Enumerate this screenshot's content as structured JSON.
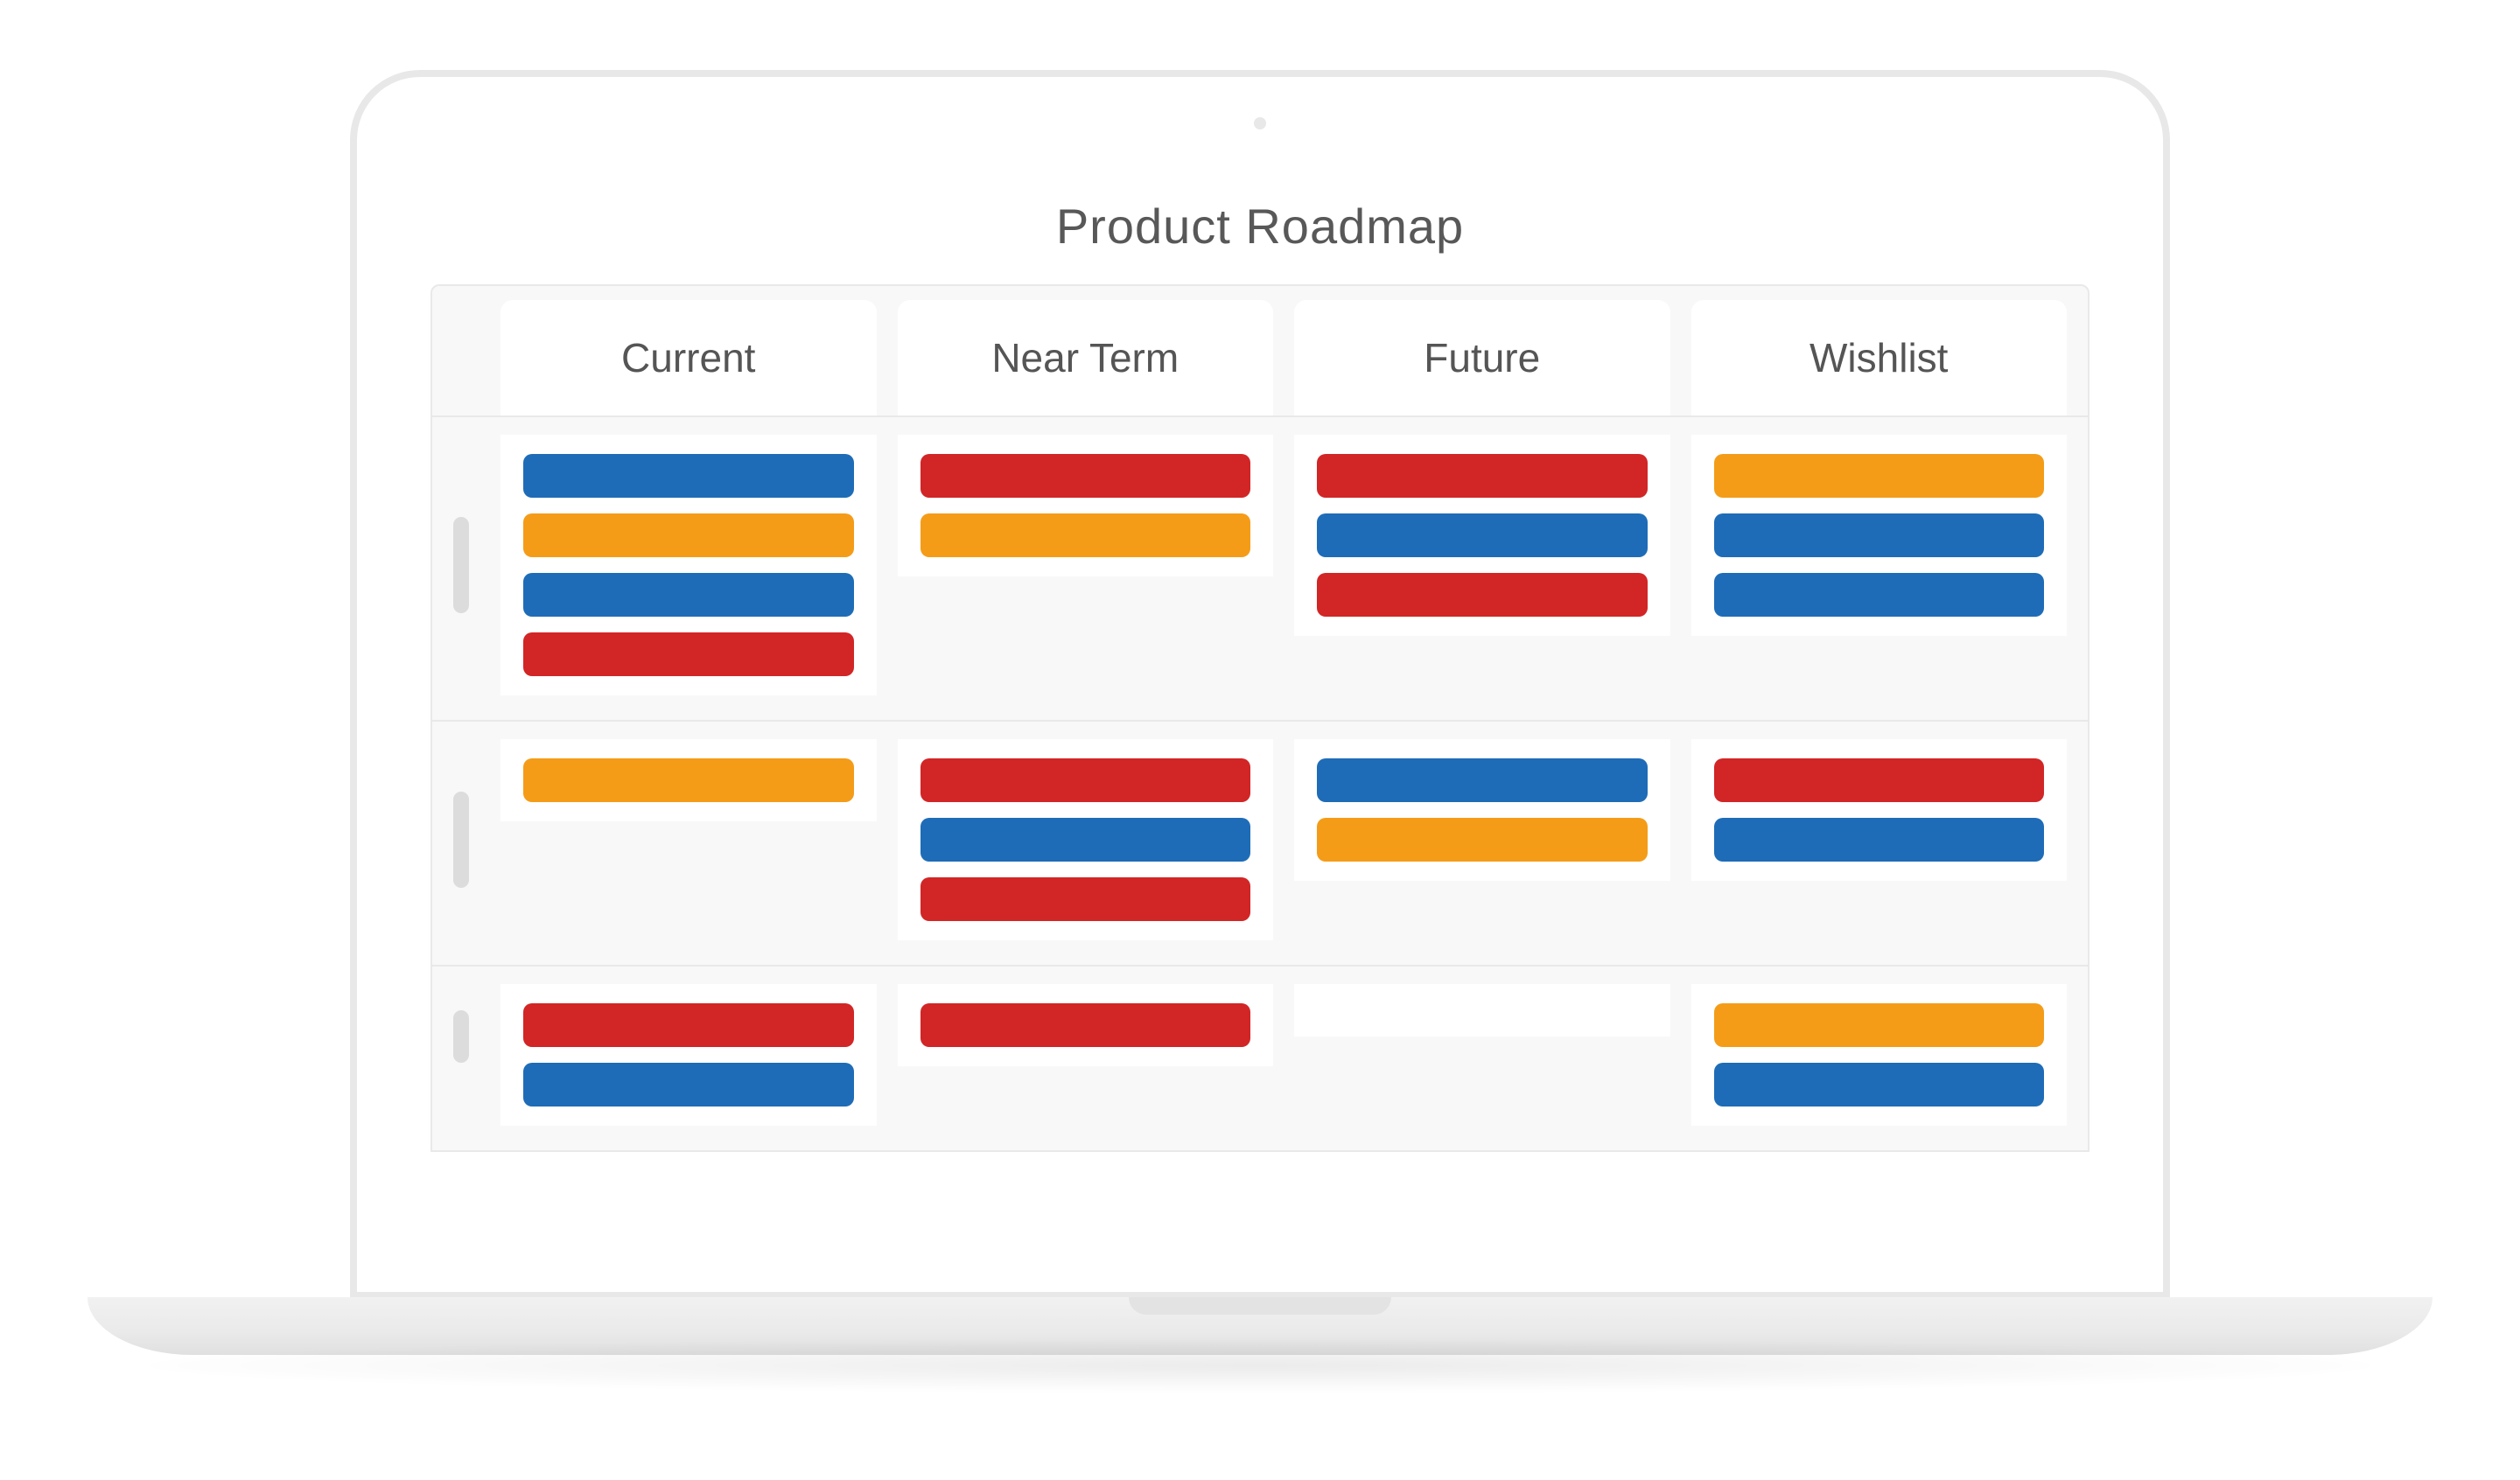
{
  "title": "Product Roadmap",
  "colors": {
    "blue": "#1E6CB7",
    "orange": "#F49C18",
    "red": "#D22526"
  },
  "columns": [
    {
      "label": "Current"
    },
    {
      "label": "Near Term"
    },
    {
      "label": "Future"
    },
    {
      "label": "Wishlist"
    }
  ],
  "rows": [
    {
      "cells": [
        [
          "blue",
          "orange",
          "blue",
          "red"
        ],
        [
          "red",
          "orange"
        ],
        [
          "red",
          "blue",
          "red"
        ],
        [
          "orange",
          "blue",
          "blue"
        ]
      ]
    },
    {
      "cells": [
        [
          "orange"
        ],
        [
          "red",
          "blue",
          "red"
        ],
        [
          "blue",
          "orange"
        ],
        [
          "red",
          "blue"
        ]
      ]
    },
    {
      "cells": [
        [
          "red",
          "blue"
        ],
        [
          "red"
        ],
        [],
        [
          "orange",
          "blue"
        ]
      ]
    }
  ]
}
